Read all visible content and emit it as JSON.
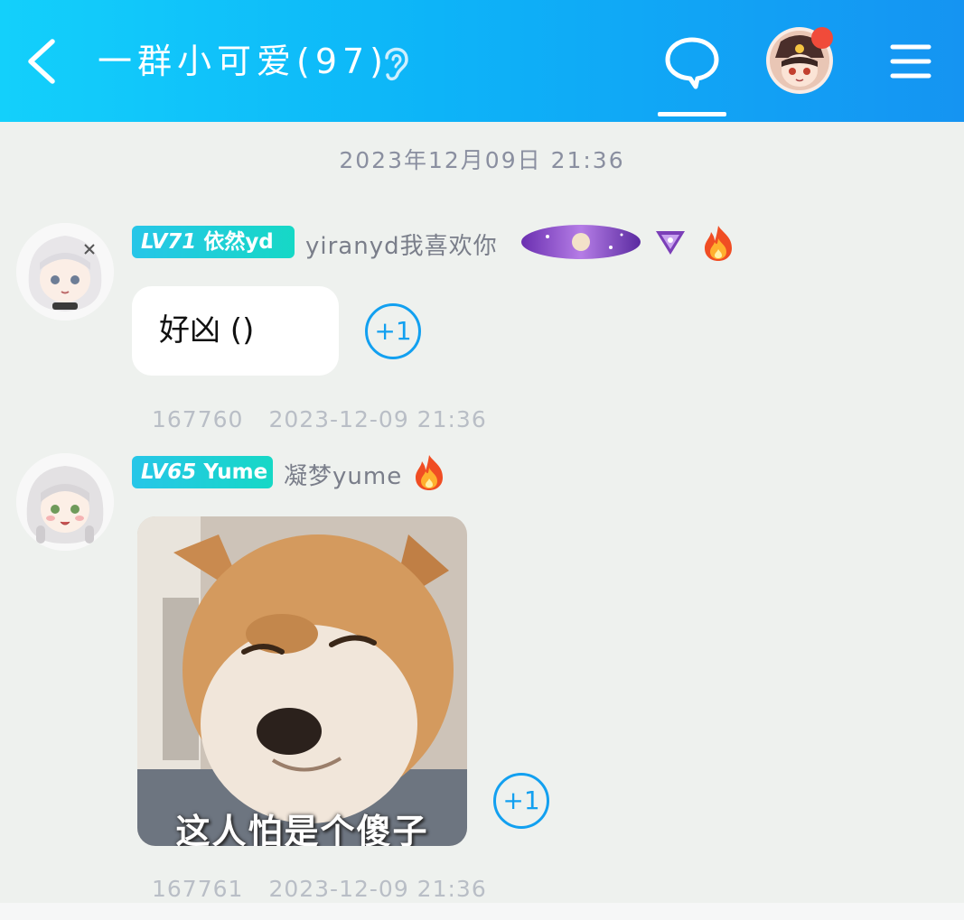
{
  "header": {
    "title": "一群小可爱(97)",
    "gradient_start": "#13d0fb",
    "gradient_end": "#1594f2"
  },
  "chat": {
    "timestamp": "2023年12月09日 21:36",
    "messages": [
      {
        "level": "LV71",
        "title_name": "依然yd",
        "nickname": "yiranyd我喜欢你",
        "text": "好凶 ()",
        "plus_one": "+1",
        "msg_id": "167760",
        "time": "2023-12-09 21:36"
      },
      {
        "level": "LV65",
        "title_name": "Yume",
        "nickname": "凝梦yume",
        "sticker_caption": "这人怕是个傻子",
        "plus_one": "+1",
        "msg_id": "167761",
        "time": "2023-12-09 21:36"
      }
    ]
  },
  "icons": {
    "back": "chevron-left-icon",
    "ear": "ear-icon",
    "chat": "chat-bubble-icon",
    "menu": "hamburger-menu-icon",
    "fire": "fire-icon"
  },
  "colors": {
    "accent": "#12a0f0",
    "badge": "#27c6e8",
    "background": "#eef1ee"
  }
}
